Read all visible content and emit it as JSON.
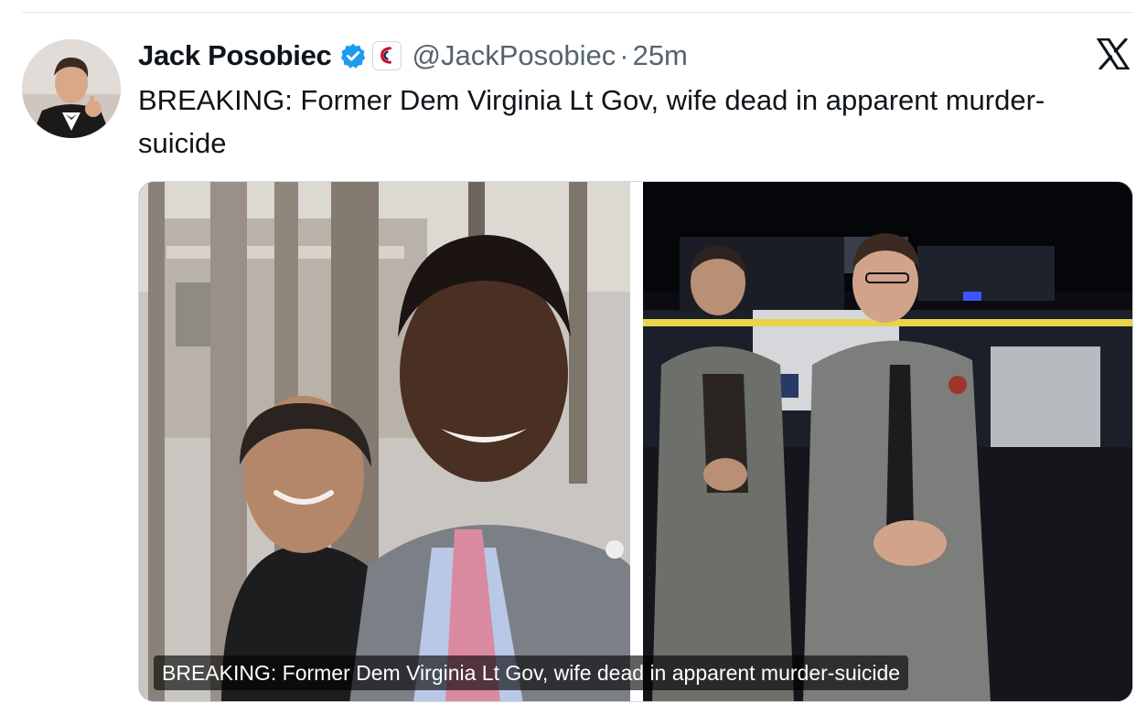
{
  "tweet": {
    "display_name": "Jack Posobiec",
    "handle": "@JackPosobiec",
    "separator": "·",
    "timestamp": "25m",
    "text": "BREAKING: Former Dem Virginia Lt Gov, wife dead in apparent murder-\nsuicide",
    "media_caption": "BREAKING: Former Dem Virginia Lt Gov, wife dead in apparent murder-suicide",
    "verified": true
  },
  "colors": {
    "verified_badge": "#1d9bf0",
    "secondary_text": "#536471",
    "primary_text": "#0f1419"
  },
  "icons": {
    "verified": "verified-badge-icon",
    "affiliation": "affiliation-badge-icon",
    "platform": "x-logo-icon"
  }
}
